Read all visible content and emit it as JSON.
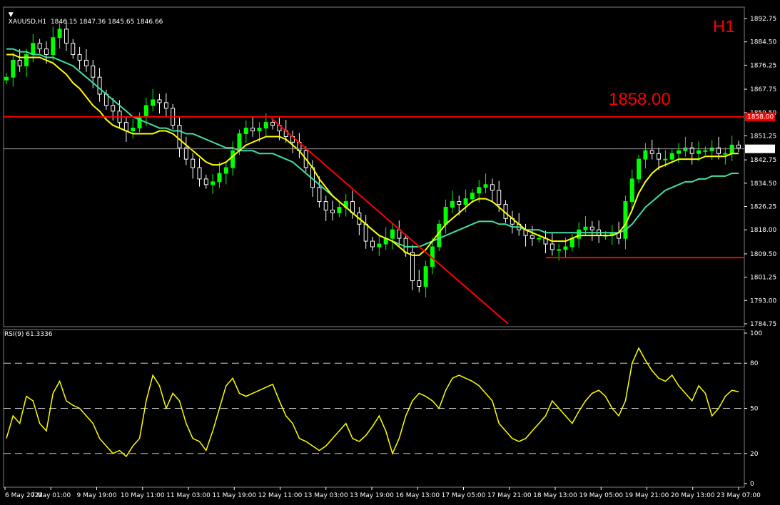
{
  "header": {
    "symbol_info": "XAUUSD,H1  1846.15 1847.36 1845.65 1846.66",
    "timeframe_badge": "H1",
    "level_text": "1858.00",
    "level_marker": "1858.00",
    "last_price": "1846.66"
  },
  "rsi_panel": {
    "label": "RSI(9) 61.3336",
    "levels": [
      "100",
      "80",
      "50",
      "20",
      "0"
    ]
  },
  "colors": {
    "background": "#000000",
    "grid": "#808080",
    "bull": "#00ff00",
    "bear": "#ffffff",
    "ma_fast": "#ffff00",
    "ma_slow": "#3fe0a0",
    "level": "#ff0000",
    "rsi": "#ffff00"
  },
  "chart_data": [
    {
      "type": "line",
      "panel": "price",
      "note_series": "candles rendered from close path",
      "ylim": [
        1784.75,
        1892.75
      ],
      "yticks": [
        "1892.75",
        "1884.50",
        "1876.25",
        "1867.75",
        "1859.50",
        "1851.25",
        "1842.75",
        "1834.50",
        "1826.25",
        "1818.00",
        "1809.50",
        "1801.25",
        "1793.00",
        "1784.75"
      ],
      "xticks": [
        "6 May 2022",
        "7 May 01:00",
        "9 May 19:00",
        "10 May 11:00",
        "11 May 03:00",
        "11 May 19:00",
        "12 May 11:00",
        "13 May 03:00",
        "13 May 19:00",
        "16 May 13:00",
        "17 May 05:00",
        "17 May 21:00",
        "18 May 13:00",
        "19 May 05:00",
        "19 May 21:00",
        "20 May 13:00",
        "23 May 07:00"
      ],
      "close": [
        1872,
        1878,
        1876,
        1880,
        1884,
        1882,
        1880,
        1886,
        1889,
        1884,
        1880,
        1878,
        1876,
        1872,
        1866,
        1862,
        1860,
        1856,
        1853,
        1854,
        1858,
        1862,
        1864,
        1863,
        1861,
        1855,
        1847,
        1843,
        1840,
        1836,
        1834,
        1835,
        1838,
        1840,
        1846,
        1852,
        1854,
        1853,
        1854,
        1856,
        1855,
        1853,
        1851,
        1849,
        1846,
        1840,
        1833,
        1828,
        1825,
        1824,
        1826,
        1828,
        1824,
        1820,
        1814,
        1812,
        1813,
        1815,
        1818,
        1815,
        1810,
        1800,
        1798,
        1805,
        1812,
        1820,
        1826,
        1828,
        1827,
        1829,
        1831,
        1833,
        1834,
        1832,
        1827,
        1822,
        1820,
        1818,
        1816,
        1815,
        1815,
        1813,
        1811,
        1811,
        1812,
        1815,
        1818,
        1819,
        1818,
        1816,
        1816,
        1817,
        1815,
        1828,
        1836,
        1843,
        1846,
        1845,
        1843,
        1843,
        1845,
        1846,
        1847,
        1845,
        1846,
        1846,
        1847,
        1845,
        1845,
        1848,
        1847
      ],
      "ma_fast": [
        1880,
        1880,
        1879,
        1879,
        1879,
        1879,
        1878,
        1877,
        1875,
        1873,
        1870,
        1868,
        1865,
        1862,
        1860,
        1857,
        1855,
        1854,
        1853,
        1852,
        1852,
        1852,
        1852,
        1853,
        1853,
        1852,
        1850,
        1848,
        1846,
        1844,
        1842,
        1841,
        1841,
        1842,
        1844,
        1846,
        1848,
        1849,
        1850,
        1851,
        1851,
        1851,
        1850,
        1848,
        1846,
        1843,
        1840,
        1836,
        1833,
        1830,
        1828,
        1826,
        1824,
        1822,
        1820,
        1818,
        1816,
        1815,
        1814,
        1812,
        1810,
        1809,
        1809,
        1811,
        1814,
        1817,
        1820,
        1822,
        1824,
        1826,
        1828,
        1829,
        1829,
        1828,
        1826,
        1824,
        1822,
        1820,
        1818,
        1817,
        1816,
        1815,
        1814,
        1814,
        1814,
        1815,
        1816,
        1816,
        1816,
        1816,
        1816,
        1816,
        1817,
        1820,
        1825,
        1831,
        1835,
        1838,
        1840,
        1841,
        1842,
        1843,
        1843,
        1843,
        1843,
        1844,
        1844,
        1844,
        1844,
        1845,
        1845
      ],
      "ma_slow": [
        1882,
        1882,
        1881,
        1881,
        1880,
        1880,
        1879,
        1879,
        1878,
        1877,
        1876,
        1874,
        1872,
        1870,
        1868,
        1866,
        1864,
        1862,
        1860,
        1858,
        1857,
        1856,
        1855,
        1854,
        1854,
        1853,
        1853,
        1852,
        1852,
        1851,
        1850,
        1849,
        1848,
        1847,
        1847,
        1846,
        1846,
        1846,
        1845,
        1845,
        1845,
        1844,
        1843,
        1842,
        1840,
        1838,
        1836,
        1834,
        1832,
        1830,
        1828,
        1826,
        1824,
        1822,
        1820,
        1818,
        1816,
        1815,
        1814,
        1813,
        1812,
        1812,
        1812,
        1813,
        1814,
        1815,
        1816,
        1817,
        1818,
        1819,
        1820,
        1821,
        1821,
        1821,
        1820,
        1820,
        1819,
        1819,
        1818,
        1818,
        1818,
        1817,
        1817,
        1817,
        1817,
        1817,
        1817,
        1817,
        1817,
        1817,
        1817,
        1817,
        1817,
        1818,
        1820,
        1823,
        1826,
        1828,
        1830,
        1832,
        1833,
        1834,
        1835,
        1835,
        1836,
        1836,
        1837,
        1837,
        1837,
        1838,
        1838
      ]
    },
    {
      "type": "line",
      "panel": "rsi",
      "ylim": [
        0,
        100
      ],
      "yticks": [
        "100",
        "80",
        "50",
        "20",
        "0"
      ],
      "values": [
        30,
        45,
        40,
        58,
        55,
        40,
        35,
        60,
        68,
        55,
        52,
        50,
        45,
        40,
        30,
        25,
        20,
        22,
        18,
        25,
        30,
        55,
        72,
        65,
        50,
        60,
        55,
        40,
        30,
        28,
        22,
        35,
        50,
        65,
        70,
        60,
        58,
        60,
        62,
        64,
        66,
        55,
        45,
        40,
        30,
        28,
        25,
        22,
        25,
        30,
        35,
        40,
        30,
        28,
        32,
        38,
        45,
        35,
        20,
        30,
        45,
        55,
        60,
        58,
        55,
        50,
        62,
        70,
        72,
        70,
        68,
        65,
        60,
        55,
        40,
        35,
        30,
        28,
        30,
        35,
        40,
        45,
        55,
        50,
        45,
        40,
        48,
        55,
        60,
        62,
        58,
        50,
        45,
        55,
        80,
        90,
        82,
        75,
        70,
        68,
        72,
        65,
        60,
        55,
        65,
        60,
        45,
        50,
        58,
        62,
        61
      ]
    }
  ]
}
